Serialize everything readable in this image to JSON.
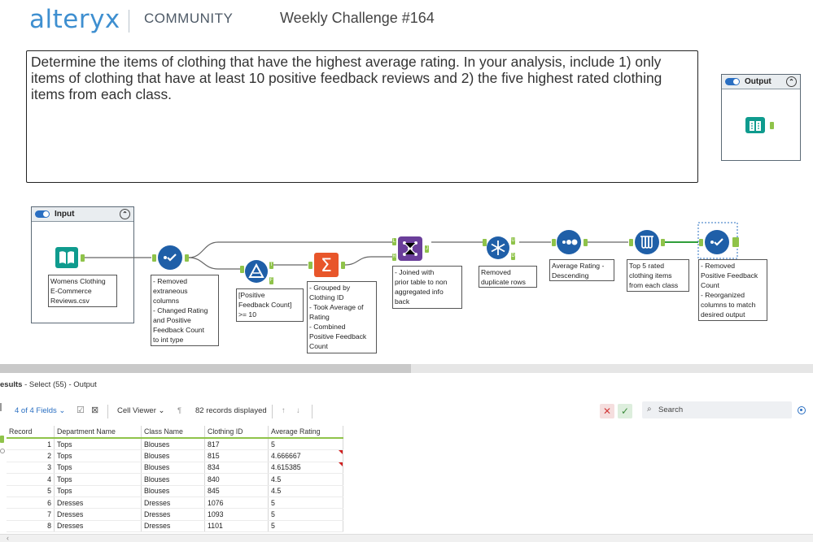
{
  "header": {
    "logo": "alteryx",
    "community": "COMMUNITY",
    "title": "Weekly Challenge #164"
  },
  "description": "Determine the items of clothing that have the highest average rating.  In your analysis, include 1) only items of clothing that have at least 10 positive feedback reviews and  2) the five highest rated clothing items from each class.",
  "containers": {
    "input": "Input",
    "output": "Output"
  },
  "tools": {
    "input_label": "Womens Clothing\nE-Commerce\nReviews.csv",
    "select1_label": "- Removed\nextraneous\ncolumns\n- Changed Rating\nand Positive\nFeedback Count\nto int type",
    "filter_label": "[Positive\nFeedback Count]\n>= 10",
    "filter_t": "T",
    "filter_f": "F",
    "summarize_label": "- Grouped by\nClothing ID\n- Took Average of\nRating\n- Combined\nPositive Feedback\nCount",
    "join_label": "- Joined with\nprior table to non\naggregated info\nback",
    "join_l": "L",
    "join_r": "R",
    "join_j": "J",
    "unique_label": "Removed\nduplicate rows",
    "unique_u": "U",
    "unique_d": "D",
    "sort_label": "Average Rating -\nDescending",
    "sample_label": "Top 5 rated\nclothing items\nfrom each class",
    "select2_label": "- Removed\nPositive Feedback\nCount\n- Reorganized\ncolumns to match\ndesired output"
  },
  "results": {
    "title_bold": "esults",
    "title_rest": " - Select (55) - Output",
    "fields": "4 of 4 Fields",
    "viewer": "Cell Viewer",
    "records": "82 records displayed",
    "search_placeholder": "Search",
    "columns": [
      "Record",
      "Department Name",
      "Class Name",
      "Clothing ID",
      "Average Rating"
    ],
    "rows": [
      [
        "1",
        "Tops",
        "Blouses",
        "817",
        "5"
      ],
      [
        "2",
        "Tops",
        "Blouses",
        "815",
        "4.666667"
      ],
      [
        "3",
        "Tops",
        "Blouses",
        "834",
        "4.615385"
      ],
      [
        "4",
        "Tops",
        "Blouses",
        "840",
        "4.5"
      ],
      [
        "5",
        "Tops",
        "Blouses",
        "845",
        "4.5"
      ],
      [
        "6",
        "Dresses",
        "Dresses",
        "1076",
        "5"
      ],
      [
        "7",
        "Dresses",
        "Dresses",
        "1093",
        "5"
      ],
      [
        "8",
        "Dresses",
        "Dresses",
        "1101",
        "5"
      ]
    ]
  },
  "colors": {
    "brand": "#3e8fd0",
    "tool_blue": "#1f5fa8",
    "tool_teal": "#0f9b8e",
    "tool_orange": "#e8562a",
    "tool_purple": "#6a3e9a",
    "anchor_green": "#8fc34a"
  }
}
